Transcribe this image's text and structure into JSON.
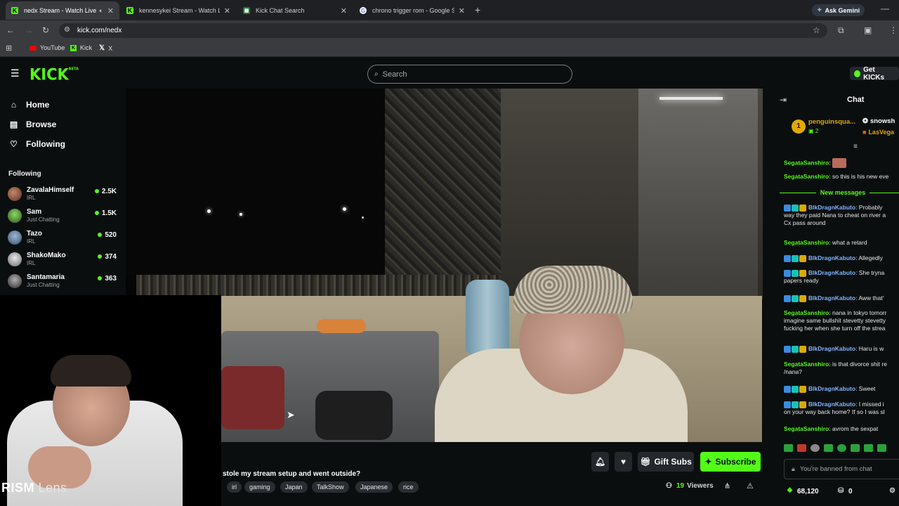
{
  "browser": {
    "tabs": [
      {
        "title": "nedx Stream - Watch Live o",
        "active": true
      },
      {
        "title": "kennesykei Stream - Watch Live",
        "active": false
      },
      {
        "title": "Kick Chat Search",
        "active": false
      },
      {
        "title": "chrono trigger rom - Google Se",
        "active": false
      }
    ],
    "ask_gemini": "Ask Gemini",
    "url": "kick.com/nedx",
    "bookmarks": [
      "YouTube",
      "Kick",
      "X"
    ]
  },
  "header": {
    "logo": "KICK",
    "logo_sup": "BETA",
    "search_placeholder": "Search",
    "get_kicks": "Get KICKs"
  },
  "sidebar": {
    "nav": [
      {
        "label": "Home",
        "icon": "home-icon"
      },
      {
        "label": "Browse",
        "icon": "browse-icon"
      },
      {
        "label": "Following",
        "icon": "heart-icon"
      }
    ],
    "following_title": "Following",
    "following": [
      {
        "name": "ZavalaHimself",
        "category": "IRL",
        "viewers": "2.5K"
      },
      {
        "name": "Sam",
        "category": "Just Chatting",
        "viewers": "1.5K"
      },
      {
        "name": "Tazo",
        "category": "IRL",
        "viewers": "520"
      },
      {
        "name": "ShakoMako",
        "category": "IRL",
        "viewers": "374"
      },
      {
        "name": "Santamaria",
        "category": "Just Chatting",
        "viewers": "363"
      }
    ]
  },
  "overlay": {
    "prism_bold": "RISM",
    "prism_light": "Lens"
  },
  "stream": {
    "title": "stole my stream setup and went outside?",
    "tags": [
      "irl",
      "gaming",
      "Japan",
      "TalkShow",
      "Japanese",
      "rice"
    ],
    "gift_subs": "Gift Subs",
    "subscribe": "Subscribe",
    "viewers_count": "19",
    "viewers_label": "Viewers"
  },
  "chat": {
    "title": "Chat",
    "pinned": [
      {
        "name": "penguinsqua...",
        "count": "2",
        "rank": "1"
      },
      {
        "name": "snowsh",
        "sub": "LasVega"
      }
    ],
    "new_messages_label": "New messages",
    "messages": [
      {
        "user": "SegataSanshiro",
        "text": "",
        "color": "#53fc18"
      },
      {
        "user": "SegataSanshiro",
        "text": "so this is his new eve",
        "color": "#53fc18"
      },
      {
        "user": "BlkDragnKabuto",
        "text": "Probably",
        "line2": "way they paid Nana to cheat on river a",
        "line3": "Cx pass around",
        "color": "#7fb6ff"
      },
      {
        "user": "SegataSanshiro",
        "text": "what a retard",
        "color": "#53fc18"
      },
      {
        "user": "BlkDragnKabuto",
        "text": "Allegedly",
        "color": "#7fb6ff"
      },
      {
        "user": "BlkDragnKabuto",
        "text": "She tryna",
        "line2": "papers ready",
        "color": "#7fb6ff"
      },
      {
        "user": "BlkDragnKabuto",
        "text": "Aww that'",
        "color": "#7fb6ff"
      },
      {
        "user": "SegataSanshiro",
        "text": "nana in tokyo tomorr",
        "line2": "imagine same bullshit stevetty stevetty",
        "line3": "fucking her when she turn off the strea",
        "color": "#53fc18"
      },
      {
        "user": "BlkDragnKabuto",
        "text": "Haru is w",
        "color": "#7fb6ff"
      },
      {
        "user": "SegataSanshiro",
        "text": "is that divorce shit re",
        "line2": "/nana?",
        "color": "#53fc18"
      },
      {
        "user": "BlkDragnKabuto",
        "text": "Sweet",
        "color": "#7fb6ff"
      },
      {
        "user": "BlkDragnKabuto",
        "text": "I missed i",
        "line2": "on your way back home? If so I was sl",
        "color": "#7fb6ff"
      },
      {
        "user": "SegataSanshiro",
        "text": "avrom the sexpat",
        "color": "#53fc18"
      }
    ],
    "input_placeholder": "You're banned from chat",
    "kicks_balance": "68,120",
    "points": "0"
  },
  "colors": {
    "accent": "#53fc18",
    "background": "#0b0e0f",
    "tab_bar": "#1f2023",
    "url_bar": "#3a3b3e"
  }
}
